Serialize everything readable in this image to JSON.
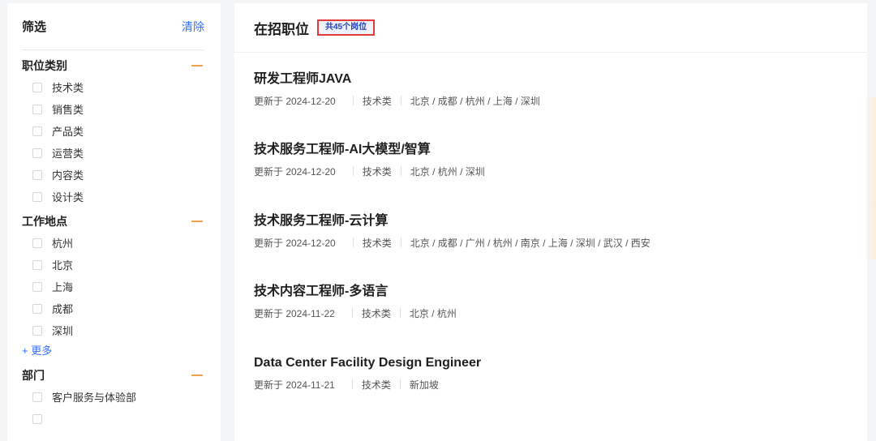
{
  "sidebar": {
    "title": "筛选",
    "clear_label": "清除",
    "groups": [
      {
        "title": "职位类别",
        "items": [
          "技术类",
          "销售类",
          "产品类",
          "运营类",
          "内容类",
          "设计类"
        ]
      },
      {
        "title": "工作地点",
        "items": [
          "杭州",
          "北京",
          "上海",
          "成都",
          "深圳"
        ],
        "more_label": "+ 更多"
      },
      {
        "title": "部门",
        "items": [
          "客户服务与体验部"
        ]
      }
    ]
  },
  "main": {
    "title": "在招职位",
    "count_badge": "共45个岗位",
    "jobs": [
      {
        "title": "研发工程师JAVA",
        "date": "更新于 2024-12-20",
        "category": "技术类",
        "locations": "北京 / 成都 / 杭州 / 上海 / 深圳"
      },
      {
        "title": "技术服务工程师-AI大模型/智算",
        "date": "更新于 2024-12-20",
        "category": "技术类",
        "locations": "北京 / 杭州 / 深圳"
      },
      {
        "title": "技术服务工程师-云计算",
        "date": "更新于 2024-12-20",
        "category": "技术类",
        "locations": "北京 / 成都 / 广州 / 杭州 / 南京 / 上海 / 深圳 / 武汉 / 西安"
      },
      {
        "title": "技术内容工程师-多语言",
        "date": "更新于 2024-11-22",
        "category": "技术类",
        "locations": "北京 / 杭州"
      },
      {
        "title": "Data Center Facility Design Engineer",
        "date": "更新于 2024-11-21",
        "category": "技术类",
        "locations": "新加坡"
      }
    ]
  },
  "colors": {
    "accent": "#3370ff",
    "collapse": "#f6a04d",
    "badge_border": "#e03a3a"
  },
  "icons": {
    "collapse": "minus-icon",
    "checkbox": "checkbox-icon"
  }
}
